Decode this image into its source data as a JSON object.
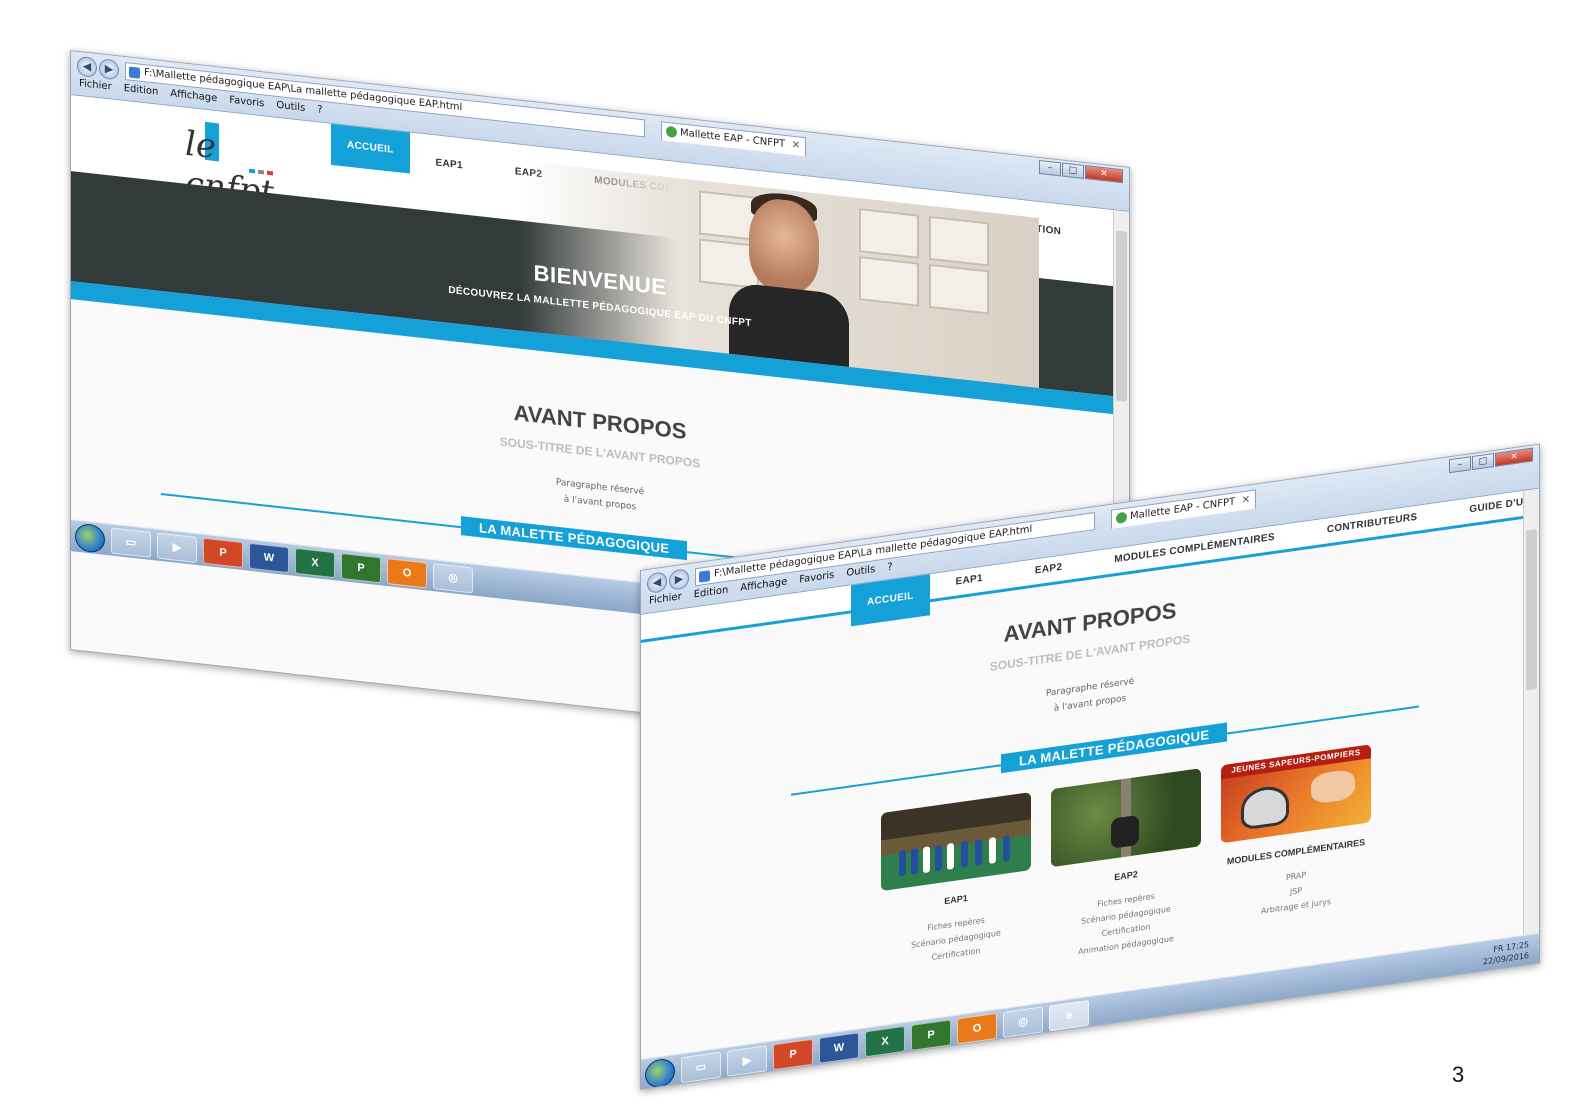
{
  "browser": {
    "address": "F:\\Mallette pédagogique EAP\\La mallette pédagogique EAP.html",
    "tab_title": "Mallette EAP - CNFPT",
    "menu": [
      "Fichier",
      "Edition",
      "Affichage",
      "Favoris",
      "Outils",
      "?"
    ]
  },
  "site": {
    "logo_text": "le cnfpt",
    "nav": [
      "ACCUEIL",
      "EAP1",
      "EAP2",
      "MODULES COMPLÉMENTAIRES",
      "CONTRIBUTEURS",
      "GUIDE D'UTILISATION"
    ],
    "hero_title": "BIENVENUE",
    "hero_subtitle": "DÉCOUVREZ LA MALLETTE PÉDAGOGIQUE EAP DU CNFPT",
    "avant_title": "AVANT PROPOS",
    "avant_subtitle": "SOUS-TITRE DE L'AVANT PROPOS",
    "avant_para_1": "Paragraphe réservé",
    "avant_para_2": "à l'avant propos",
    "section_label": "LA MALETTE PÉDAGOGIQUE",
    "cards": [
      {
        "title": "EAP1",
        "links": [
          "Fiches repères",
          "Scénario pédagogique",
          "Certification"
        ]
      },
      {
        "title": "EAP2",
        "links": [
          "Fiches repères",
          "Scénario pédagogique",
          "Certification",
          "Animation pédagogique"
        ]
      },
      {
        "title": "MODULES COMPLÉMENTAIRES",
        "banner": "JEUNES SAPEURS-POMPIERS",
        "links": [
          "PRAP",
          "JSP",
          "Arbitrage et jurys"
        ]
      }
    ]
  },
  "taskbar": {
    "apps": [
      "P",
      "W",
      "X",
      "P",
      "O"
    ],
    "tray_lang": "FR",
    "tray_time": "17:25",
    "tray_date": "22/09/2016"
  },
  "slide": {
    "page_number": "3"
  },
  "colors": {
    "accent": "#14a1d8",
    "hero_dark": "#323a3a"
  }
}
